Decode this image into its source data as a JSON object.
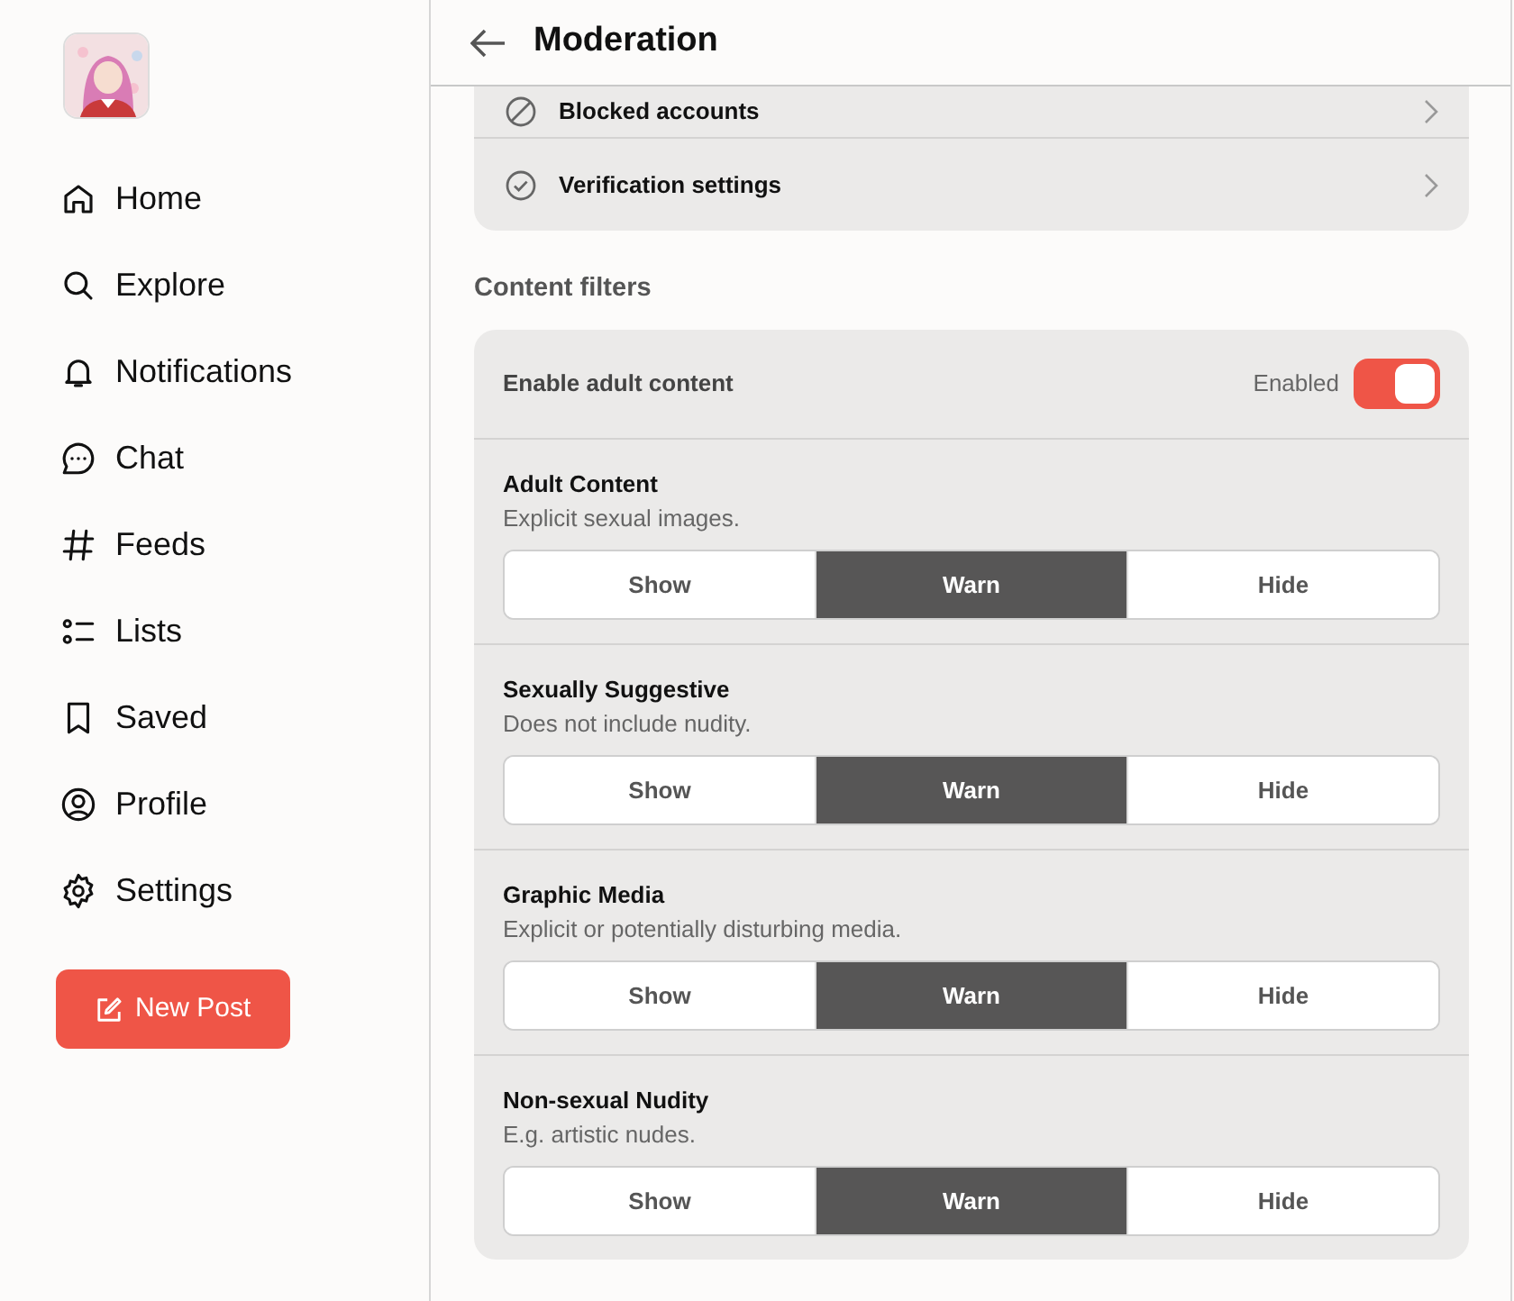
{
  "sidebar": {
    "items": [
      {
        "label": "Home",
        "kind": "home"
      },
      {
        "label": "Explore",
        "kind": "search"
      },
      {
        "label": "Notifications",
        "kind": "bell"
      },
      {
        "label": "Chat",
        "kind": "chat"
      },
      {
        "label": "Feeds",
        "kind": "hash"
      },
      {
        "label": "Lists",
        "kind": "list"
      },
      {
        "label": "Saved",
        "kind": "bookmark"
      },
      {
        "label": "Profile",
        "kind": "person"
      },
      {
        "label": "Settings",
        "kind": "gear"
      }
    ],
    "new_post": "New Post"
  },
  "header": {
    "title": "Moderation"
  },
  "account_rows": [
    {
      "label": "Blocked accounts",
      "kind": "blocked"
    },
    {
      "label": "Verification settings",
      "kind": "check"
    }
  ],
  "content_filters": {
    "heading": "Content filters",
    "adult_toggle": {
      "label": "Enable adult content",
      "state_label": "Enabled",
      "on": true
    },
    "filters": [
      {
        "title": "Adult Content",
        "description": "Explicit sexual images.",
        "options": [
          {
            "label": "Show",
            "selected": false
          },
          {
            "label": "Warn",
            "selected": true
          },
          {
            "label": "Hide",
            "selected": false
          }
        ]
      },
      {
        "title": "Sexually Suggestive",
        "description": "Does not include nudity.",
        "options": [
          {
            "label": "Show",
            "selected": false
          },
          {
            "label": "Warn",
            "selected": true
          },
          {
            "label": "Hide",
            "selected": false
          }
        ]
      },
      {
        "title": "Graphic Media",
        "description": "Explicit or potentially disturbing media.",
        "options": [
          {
            "label": "Show",
            "selected": false
          },
          {
            "label": "Warn",
            "selected": true
          },
          {
            "label": "Hide",
            "selected": false
          }
        ]
      },
      {
        "title": "Non-sexual Nudity",
        "description": "E.g. artistic nudes.",
        "options": [
          {
            "label": "Show",
            "selected": false
          },
          {
            "label": "Warn",
            "selected": true
          },
          {
            "label": "Hide",
            "selected": false
          }
        ]
      }
    ]
  }
}
